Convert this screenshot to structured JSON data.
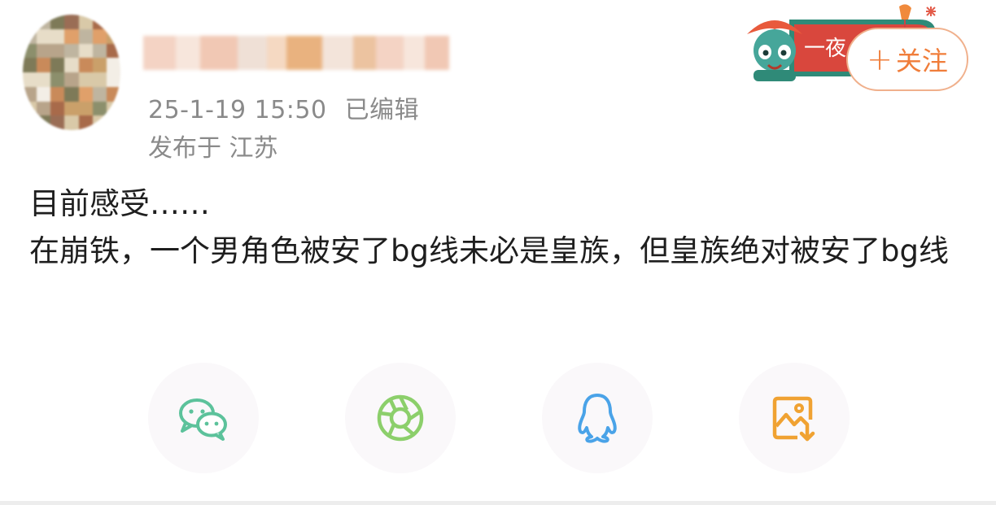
{
  "header": {
    "username": "",
    "timestamp": "25-1-19 15:50",
    "edited_label": "已编辑",
    "location": "发布于 江苏",
    "follow_label": "关注",
    "follow_plus": "+",
    "banner_text": "一夜"
  },
  "post": {
    "text": "目前感受……\n在崩铁，一个男角色被安了bg线未必是皇族，但皇族绝对被安了bg线"
  },
  "share": {
    "items": [
      {
        "icon": "wechat-icon",
        "color": "#5cc29b"
      },
      {
        "icon": "moments-icon",
        "color": "#8ccf6b"
      },
      {
        "icon": "qq-icon",
        "color": "#4aa3e8"
      },
      {
        "icon": "save-image-icon",
        "color": "#f0a232"
      }
    ]
  },
  "colors": {
    "accent": "#f07d3a",
    "meta_text": "#8a8a8a",
    "share_bg": "#faf8fa"
  }
}
